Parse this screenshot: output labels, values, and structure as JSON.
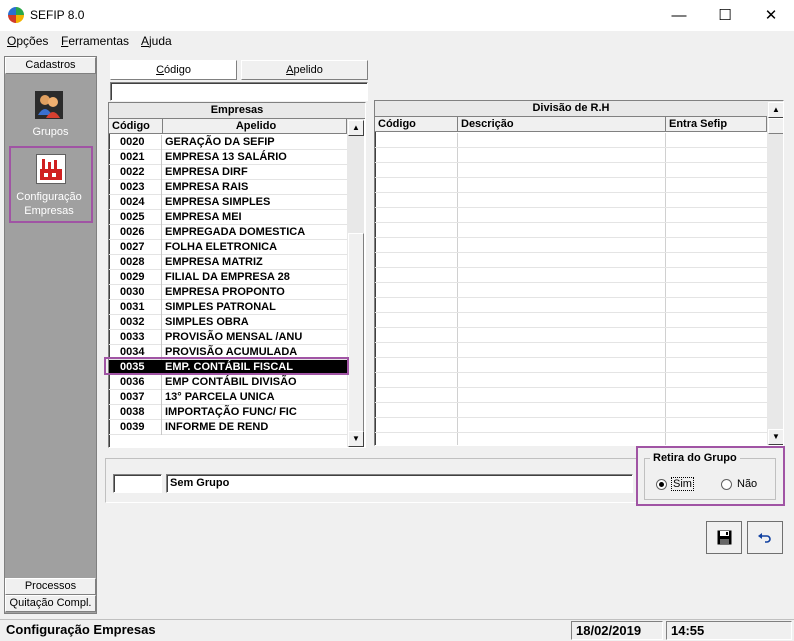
{
  "window": {
    "title": "SEFIP 8.0",
    "minimize": "—",
    "maximize": "☐",
    "close": "✕"
  },
  "menu": [
    {
      "label": "Opções",
      "accel": "O",
      "rest": "pções"
    },
    {
      "label": "Ferramentas",
      "accel": "F",
      "rest": "erramentas"
    },
    {
      "label": "Ajuda",
      "accel": "A",
      "rest": "juda"
    }
  ],
  "sidebar": {
    "header": "Cadastros",
    "items": [
      {
        "label": "Grupos",
        "icon": "users-icon"
      },
      {
        "label_line1": "Configuração",
        "label_line2": "Empresas",
        "icon": "factory-icon"
      }
    ],
    "footer_items": [
      "Processos",
      "Quitação Compl."
    ]
  },
  "tabs": [
    {
      "label": "Código",
      "accel": "C",
      "rest": "ódigo",
      "active": true
    },
    {
      "label": "Apelido",
      "accel": "A",
      "rest": "pelido",
      "active": false
    }
  ],
  "search": {
    "value": ""
  },
  "empresas": {
    "title": "Empresas",
    "columns": [
      "Código",
      "Apelido"
    ],
    "rows": [
      {
        "codigo": "0020",
        "apelido": "GERAÇÃO DA SEFIP"
      },
      {
        "codigo": "0021",
        "apelido": "EMPRESA 13 SALÁRIO"
      },
      {
        "codigo": "0022",
        "apelido": "EMPRESA DIRF"
      },
      {
        "codigo": "0023",
        "apelido": "EMPRESA RAIS"
      },
      {
        "codigo": "0024",
        "apelido": "EMPRESA SIMPLES"
      },
      {
        "codigo": "0025",
        "apelido": "EMPRESA MEI"
      },
      {
        "codigo": "0026",
        "apelido": "EMPREGADA DOMESTICA"
      },
      {
        "codigo": "0027",
        "apelido": "FOLHA ELETRONICA"
      },
      {
        "codigo": "0028",
        "apelido": "EMPRESA MATRIZ"
      },
      {
        "codigo": "0029",
        "apelido": "FILIAL DA EMPRESA 28"
      },
      {
        "codigo": "0030",
        "apelido": "EMPRESA PROPONTO"
      },
      {
        "codigo": "0031",
        "apelido": "SIMPLES PATRONAL"
      },
      {
        "codigo": "0032",
        "apelido": "SIMPLES OBRA"
      },
      {
        "codigo": "0033",
        "apelido": "PROVISÃO MENSAL /ANU"
      },
      {
        "codigo": "0034",
        "apelido": "PROVISÃO ACUMULADA"
      },
      {
        "codigo": "0035",
        "apelido": "EMP. CONTÁBIL FISCAL",
        "selected": true
      },
      {
        "codigo": "0036",
        "apelido": "EMP CONTÁBIL DIVISÃO"
      },
      {
        "codigo": "0037",
        "apelido": "13° PARCELA UNICA"
      },
      {
        "codigo": "0038",
        "apelido": "IMPORTAÇÃO FUNC/ FIC"
      },
      {
        "codigo": "0039",
        "apelido": "INFORME DE REND"
      }
    ]
  },
  "divisao": {
    "title": "Divisão de R.H",
    "columns": [
      "Código",
      "Descrição",
      "Entra Sefip"
    ]
  },
  "grupo": {
    "code": "",
    "name": "Sem Grupo"
  },
  "retira_grupo": {
    "legend": "Retira do Grupo",
    "options": [
      {
        "label": "Sim",
        "checked": true
      },
      {
        "label": "Não",
        "checked": false
      }
    ]
  },
  "buttons": {
    "save_icon": "save-icon",
    "undo_icon": "undo-icon"
  },
  "status": {
    "screen": "Configuração Empresas",
    "date": "18/02/2019",
    "time": "14:55"
  }
}
